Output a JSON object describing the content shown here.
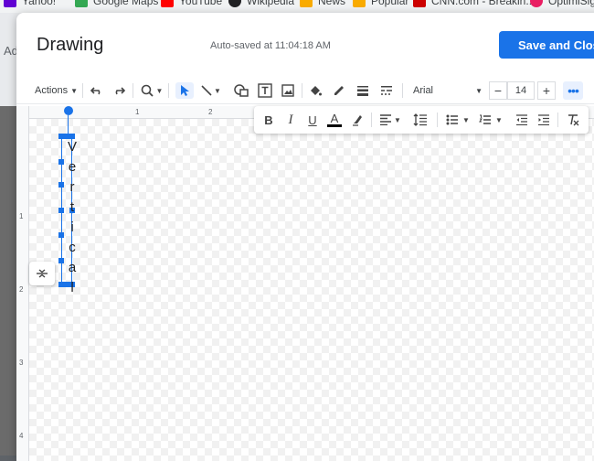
{
  "bookmarks": [
    {
      "label": "Yahoo!",
      "color": "#6001d2"
    },
    {
      "label": "Google Maps",
      "color": "#34a853"
    },
    {
      "label": "YouTube",
      "color": "#ff0000"
    },
    {
      "label": "Wikipedia",
      "color": "#202124"
    },
    {
      "label": "News",
      "color": "#f9ab00"
    },
    {
      "label": "Popular",
      "color": "#f9ab00"
    },
    {
      "label": "CNN.com - Breakin...",
      "color": "#cc0000"
    },
    {
      "label": "OptimiSig",
      "color": "#e91e63"
    }
  ],
  "background": {
    "left_text": "Ad"
  },
  "dialog": {
    "title": "Drawing",
    "autosave": "Auto-saved at 11:04:18 AM",
    "save_label": "Save and Close"
  },
  "toolbar": {
    "actions_label": "Actions",
    "font": "Arial",
    "font_size": "14",
    "icons": [
      "undo-icon",
      "redo-icon",
      "zoom-icon",
      "select-icon",
      "line-icon",
      "shape-icon",
      "textbox-icon",
      "image-icon",
      "fill-color-icon",
      "border-color-icon",
      "border-weight-icon",
      "border-dash-icon",
      "more-icon"
    ]
  },
  "format_toolbar": {
    "icons": [
      "bold-icon",
      "italic-icon",
      "underline-icon",
      "text-color-icon",
      "highlight-icon",
      "align-icon",
      "line-spacing-icon",
      "bulleted-list-icon",
      "numbered-list-icon",
      "decrease-indent-icon",
      "increase-indent-icon",
      "clear-formatting-icon"
    ],
    "bold": "B",
    "italic": "I",
    "underline": "U",
    "text_color": "A"
  },
  "ruler": {
    "h_numbers": [
      "1",
      "2"
    ],
    "v_numbers": [
      "1",
      "2",
      "3",
      "4"
    ]
  },
  "canvas": {
    "text_letters": [
      "V",
      "e",
      "r",
      "t",
      "i",
      "c",
      "a",
      "l"
    ]
  },
  "colors": {
    "accent": "#1a73e8",
    "text_color_bar": "#000000"
  }
}
